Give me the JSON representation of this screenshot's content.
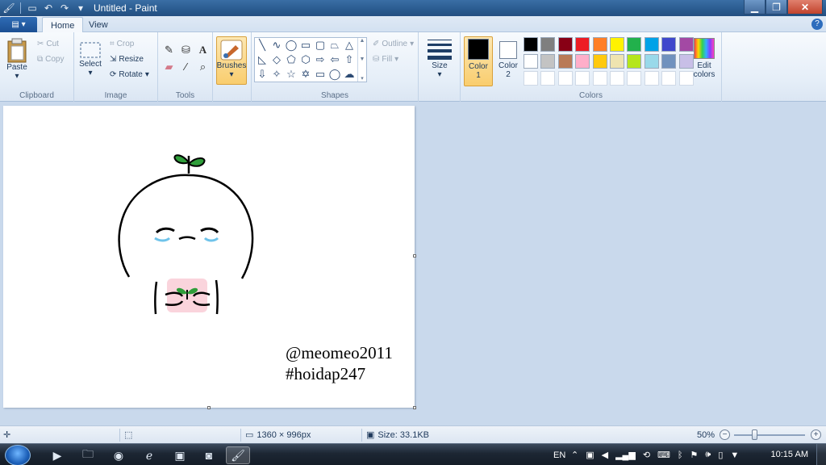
{
  "window": {
    "title": "Untitled - Paint"
  },
  "tabs": {
    "home": "Home",
    "view": "View"
  },
  "clipboard": {
    "paste": "Paste",
    "cut": "Cut",
    "copy": "Copy",
    "label": "Clipboard"
  },
  "image": {
    "select": "Select",
    "crop": "Crop",
    "resize": "Resize",
    "rotate": "Rotate",
    "label": "Image"
  },
  "tools": {
    "label": "Tools"
  },
  "brushes": {
    "label": "Brushes"
  },
  "shapes": {
    "outline": "Outline",
    "fill": "Fill",
    "label": "Shapes"
  },
  "size": {
    "label": "Size"
  },
  "colors": {
    "color1_label": "Color",
    "color1_num": "1",
    "color2_label": "Color",
    "color2_num": "2",
    "edit_label1": "Edit",
    "edit_label2": "colors",
    "label": "Colors",
    "color1_value": "#000000",
    "color2_value": "#ffffff",
    "palette_row1": [
      "#000000",
      "#7f7f7f",
      "#880015",
      "#ed1c24",
      "#ff7f27",
      "#fff200",
      "#22b14c",
      "#00a2e8",
      "#3f48cc",
      "#a349a4"
    ],
    "palette_row2": [
      "#ffffff",
      "#c3c3c3",
      "#b97a57",
      "#ffaec9",
      "#ffc90e",
      "#efe4b0",
      "#b5e61d",
      "#99d9ea",
      "#7092be",
      "#c8bfe7"
    ],
    "palette_row3": [
      "#ffffff",
      "#ffffff",
      "#ffffff",
      "#ffffff",
      "#ffffff",
      "#ffffff",
      "#ffffff",
      "#ffffff",
      "#ffffff",
      "#ffffff"
    ]
  },
  "canvas": {
    "watermark_line1": "@meomeo2011",
    "watermark_line2": "#hoidap247"
  },
  "status": {
    "dimensions": "1360 × 996px",
    "size": "Size: 33.1KB",
    "zoom": "50%",
    "zoom_fraction": 0.5
  },
  "taskbar": {
    "language": "EN",
    "clock": "10:15 AM"
  },
  "icons": {
    "app_menu": "paint-menu-icon",
    "undo": "undo-icon",
    "redo": "redo-icon",
    "help": "help-icon"
  }
}
